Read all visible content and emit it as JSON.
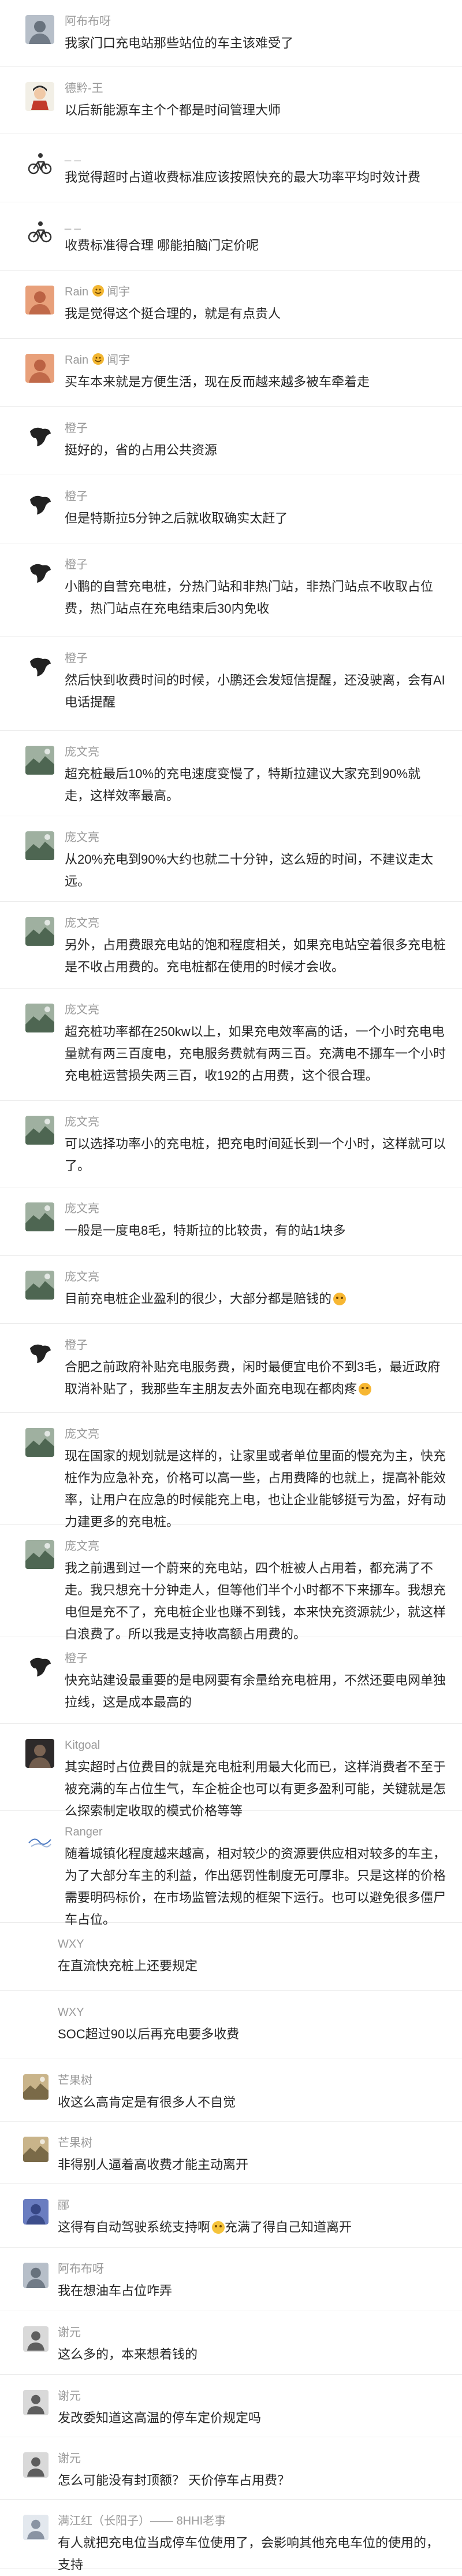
{
  "comments": [
    {
      "id": "c1",
      "name": "阿布布呀",
      "text": "我家门口充电站那些站位的车主该难受了",
      "avatar": {
        "icon": "avatar-photo-icon",
        "bg": "#b7bfc9",
        "fg": "#5a6470"
      }
    },
    {
      "id": "c2",
      "name": "德黔-王",
      "text": "以后新能源车主个个都是时间管理大师",
      "avatar": {
        "icon": "avatar-character-icon",
        "bg": "#f2efe6",
        "fg": "#c23a2b"
      }
    },
    {
      "id": "c3",
      "name": "_ _",
      "text": "我觉得超时占道收费标准应该按照快充的最大功率平均时效计费",
      "avatar": {
        "icon": "avatar-bicycle-icon",
        "bg": "#ffffff",
        "fg": "#333333"
      }
    },
    {
      "id": "c4",
      "name": "_ _",
      "text": "收费标准得合理 哪能拍脑门定价呢",
      "avatar": {
        "icon": "avatar-bicycle-icon",
        "bg": "#ffffff",
        "fg": "#333333"
      }
    },
    {
      "id": "c5",
      "name": "Rain",
      "badge": "闻宇",
      "text": "我是觉得这个挺合理的，就是有点贵人",
      "avatar": {
        "icon": "avatar-photo-icon",
        "bg": "#e8a07a",
        "fg": "#b3573a"
      }
    },
    {
      "id": "c6",
      "name": "Rain",
      "badge": "闻宇",
      "text": "买车本来就是方便生活，现在反而越来越多被车牵着走",
      "avatar": {
        "icon": "avatar-photo-icon",
        "bg": "#e8a07a",
        "fg": "#b3573a"
      }
    },
    {
      "id": "c7",
      "name": "橙子",
      "text": "挺好的，省的占用公共资源",
      "avatar": {
        "icon": "avatar-silhouette-icon",
        "bg": "#ffffff",
        "fg": "#222222"
      }
    },
    {
      "id": "c8",
      "name": "橙子",
      "text": "但是特斯拉5分钟之后就收取确实太赶了",
      "avatar": {
        "icon": "avatar-silhouette-icon",
        "bg": "#ffffff",
        "fg": "#222222"
      }
    },
    {
      "id": "c9",
      "name": "橙子",
      "text": "小鹏的自营充电桩，分热门站和非热门站，非热门站点不收取占位费，热门站点在充电结束后30内免收",
      "avatar": {
        "icon": "avatar-silhouette-icon",
        "bg": "#ffffff",
        "fg": "#222222"
      }
    },
    {
      "id": "c10",
      "name": "橙子",
      "text": "然后快到收费时间的时候，小鹏还会发短信提醒，还没驶离，会有AI电话提醒",
      "avatar": {
        "icon": "avatar-silhouette-icon",
        "bg": "#ffffff",
        "fg": "#222222"
      }
    },
    {
      "id": "c11",
      "name": "庞文亮",
      "text": "超充桩最后10%的充电速度变慢了，特斯拉建议大家充到90%就走，这样效率最高。",
      "avatar": {
        "icon": "avatar-landscape-icon",
        "bg": "#9fb0a0",
        "fg": "#4e6652"
      }
    },
    {
      "id": "c12",
      "name": "庞文亮",
      "text": "从20%充电到90%大约也就二十分钟，这么短的时间，不建议走太远。",
      "avatar": {
        "icon": "avatar-landscape-icon",
        "bg": "#9fb0a0",
        "fg": "#4e6652"
      }
    },
    {
      "id": "c13",
      "name": "庞文亮",
      "text": "另外，占用费跟充电站的饱和程度相关，如果充电站空着很多充电桩是不收占用费的。充电桩都在使用的时候才会收。",
      "avatar": {
        "icon": "avatar-landscape-icon",
        "bg": "#9fb0a0",
        "fg": "#4e6652"
      }
    },
    {
      "id": "c14",
      "name": "庞文亮",
      "text": "超充桩功率都在250kw以上，如果充电效率高的话，一个小时充电电量就有两三百度电，充电服务费就有两三百。充满电不挪车一个小时充电桩运营损失两三百，收192的占用费，这个很合理。",
      "avatar": {
        "icon": "avatar-landscape-icon",
        "bg": "#9fb0a0",
        "fg": "#4e6652"
      }
    },
    {
      "id": "c15",
      "name": "庞文亮",
      "text": "可以选择功率小的充电桩，把充电时间延长到一个小时，这样就可以了。",
      "avatar": {
        "icon": "avatar-landscape-icon",
        "bg": "#9fb0a0",
        "fg": "#4e6652"
      }
    },
    {
      "id": "c16",
      "name": "庞文亮",
      "text": "一般是一度电8毛，特斯拉的比较贵，有的站1块多",
      "avatar": {
        "icon": "avatar-landscape-icon",
        "bg": "#9fb0a0",
        "fg": "#4e6652"
      }
    },
    {
      "id": "c17",
      "name": "庞文亮",
      "text": "目前充电桩企业盈利的很少，大部分都是赔钱的",
      "emoji": "grin-emoji-icon",
      "avatar": {
        "icon": "avatar-landscape-icon",
        "bg": "#9fb0a0",
        "fg": "#4e6652"
      }
    },
    {
      "id": "c18",
      "name": "橙子",
      "text": "合肥之前政府补贴充电服务费，闲时最便宜电价不到3毛，最近政府取消补贴了，我那些车主朋友去外面充电现在都肉疼",
      "emoji": "grin-emoji-icon",
      "avatar": {
        "icon": "avatar-silhouette-icon",
        "bg": "#ffffff",
        "fg": "#222222"
      }
    },
    {
      "id": "c19",
      "name": "庞文亮",
      "text": "现在国家的规划就是这样的，让家里或者单位里面的慢充为主，快充桩作为应急补充，价格可以高一些，占用费降的也就上，提高补能效率，让用户在应急的时候能充上电，也让企业能够挺亏为盈，好有动力建更多的充电桩。",
      "avatar": {
        "icon": "avatar-landscape-icon",
        "bg": "#9fb0a0",
        "fg": "#4e6652"
      }
    },
    {
      "id": "c20",
      "name": "庞文亮",
      "text": "我之前遇到过一个蔚来的充电站，四个桩被人占用着，都充满了不走。我只想充十分钟走人，但等他们半个小时都不下来挪车。我想充电但是充不了，充电桩企业也赚不到钱，本来快充资源就少，就这样白浪费了。所以我是支持收高额占用费的。",
      "avatar": {
        "icon": "avatar-landscape-icon",
        "bg": "#9fb0a0",
        "fg": "#4e6652"
      }
    },
    {
      "id": "c21",
      "name": "橙子",
      "text": "快充站建设最重要的是电网要有余量给充电桩用，不然还要电网单独拉线，这是成本最高的",
      "avatar": {
        "icon": "avatar-silhouette-icon",
        "bg": "#ffffff",
        "fg": "#222222"
      }
    },
    {
      "id": "c22",
      "name": "Kitgoal",
      "text": "其实超时占位费目的就是充电桩利用最大化而已，这样消费者不至于被充满的车占位生气，车企桩企也可以有更多盈利可能，关键就是怎么探索制定收取的模式价格等等",
      "avatar": {
        "icon": "avatar-photo-icon",
        "bg": "#2d2a2a",
        "fg": "#8a6f5a"
      }
    },
    {
      "id": "c23",
      "name": "Ranger",
      "text": "随着城镇化程度越来越高，相对较少的资源要供应相对较多的车主，为了大部分车主的利益，作出惩罚性制度无可厚非。只是这样的价格需要明码标价，在市场监管法规的框架下运行。也可以避免很多僵尸车占位。",
      "avatar": {
        "icon": "avatar-line-icon",
        "bg": "#ffffff",
        "fg": "#4a78c2"
      }
    },
    {
      "id": "c24",
      "name": "WXY",
      "text": "在直流快充桩上还要规定",
      "avatar": null
    },
    {
      "id": "c25",
      "name": "WXY",
      "text": "SOC超过90以后再充电要多收费",
      "avatar": null
    },
    {
      "id": "c26",
      "name": "芒果树",
      "text": "收这么高肯定是有很多人不自觉",
      "avatar": {
        "icon": "avatar-landscape-icon",
        "bg": "#c9b48a",
        "fg": "#7a6a48"
      }
    },
    {
      "id": "c27",
      "name": "芒果树",
      "text": "非得别人逼着高收费才能主动离开",
      "avatar": {
        "icon": "avatar-landscape-icon",
        "bg": "#c9b48a",
        "fg": "#7a6a48"
      }
    },
    {
      "id": "c28",
      "name": "郦",
      "text": "这得有自动驾驶系统支持啊",
      "text2": "充满了得自己知道离开",
      "emoji": "smile-emoji-icon",
      "avatar": {
        "icon": "avatar-photo-icon",
        "bg": "#6a7dc0",
        "fg": "#2e3d7a"
      }
    },
    {
      "id": "c29",
      "name": "阿布布呀",
      "text": "我在想油车占位咋弄",
      "avatar": {
        "icon": "avatar-photo-icon",
        "bg": "#b7bfc9",
        "fg": "#5a6470"
      }
    },
    {
      "id": "c30",
      "name": "谢元",
      "text": "这么多的，本来想着钱的",
      "avatar": {
        "icon": "avatar-person-icon",
        "bg": "#d9d9d9",
        "fg": "#5e5e5e"
      }
    },
    {
      "id": "c31",
      "name": "谢元",
      "text": "发改委知道这高温的停车定价规定吗",
      "avatar": {
        "icon": "avatar-person-icon",
        "bg": "#d9d9d9",
        "fg": "#5e5e5e"
      }
    },
    {
      "id": "c32",
      "name": "谢元",
      "text": "怎么可能没有封顶额？ 天价停车占用费？",
      "avatar": {
        "icon": "avatar-person-icon",
        "bg": "#d9d9d9",
        "fg": "#5e5e5e"
      }
    },
    {
      "id": "c33",
      "name": "满江红（长阳子）—— 8HHI老事",
      "text": "有人就把充电位当成停车位使用了，会影响其他充电车位的使用的，支持",
      "avatar": {
        "icon": "avatar-person-icon",
        "bg": "#e3e8ee",
        "fg": "#8a94a3"
      }
    }
  ]
}
